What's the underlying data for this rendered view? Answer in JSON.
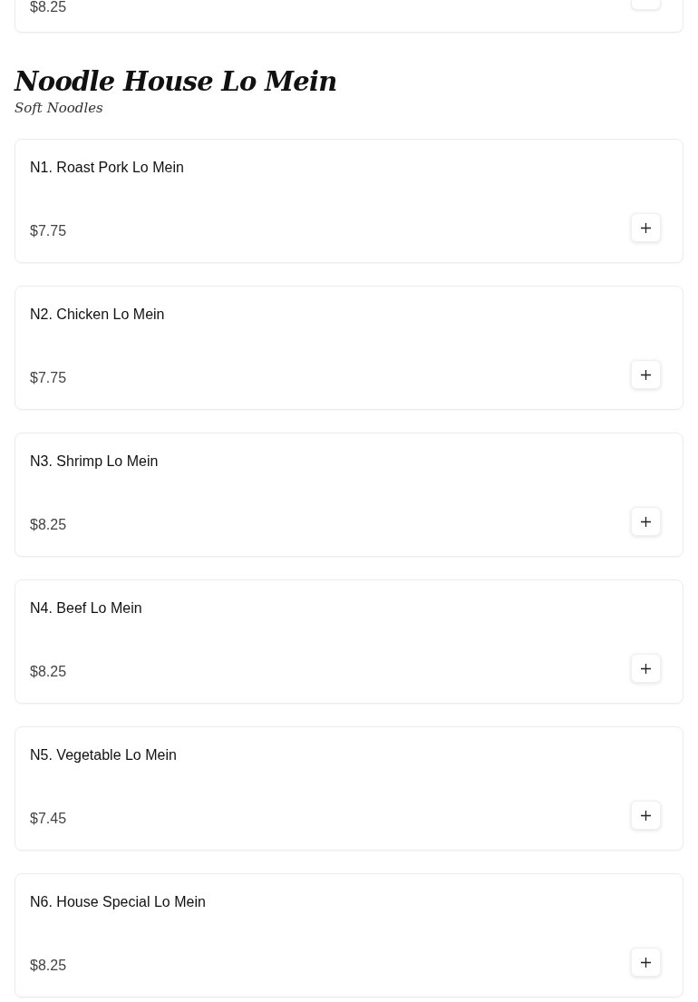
{
  "previous_item": {
    "price": "$8.25"
  },
  "section": {
    "title": "Noodle House Lo Mein",
    "subtitle": "Soft Noodles"
  },
  "items": [
    {
      "name": "N1. Roast Pork Lo Mein",
      "price": "$7.75"
    },
    {
      "name": "N2. Chicken Lo Mein",
      "price": "$7.75"
    },
    {
      "name": "N3. Shrimp Lo Mein",
      "price": "$8.25"
    },
    {
      "name": "N4. Beef Lo Mein",
      "price": "$8.25"
    },
    {
      "name": "N5. Vegetable Lo Mein",
      "price": "$7.45"
    },
    {
      "name": "N6. House Special Lo Mein",
      "price": "$8.25"
    }
  ]
}
